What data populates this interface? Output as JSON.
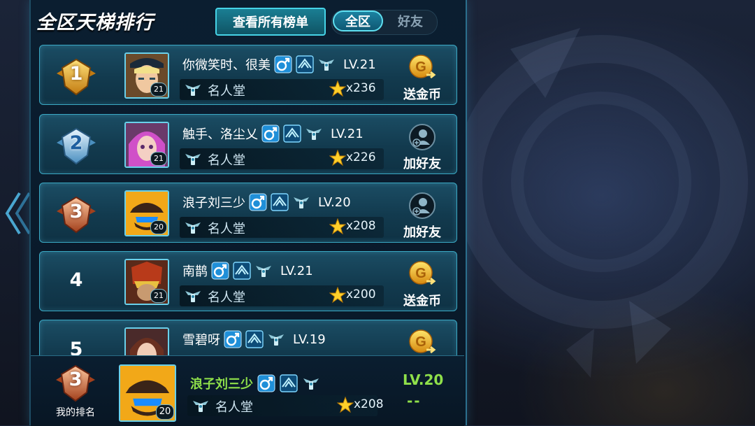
{
  "header": {
    "title": "全区天梯排行",
    "view_all_label": "查看所有榜单",
    "tabs": [
      {
        "label": "全区",
        "active": true
      },
      {
        "label": "好友",
        "active": false
      }
    ]
  },
  "colors": {
    "accent": "#46d3e6",
    "highlight_green": "#8fe04a",
    "panel_bg": "#123a4e",
    "gold": "#f2b21a"
  },
  "rankings": [
    {
      "rank": "1",
      "name": "你微笑时、很美",
      "level": "LV.21",
      "avatar_level": "21",
      "title": "名人堂",
      "stars": "x236",
      "action": "送金币",
      "action_icon": "gold-coin-send-icon"
    },
    {
      "rank": "2",
      "name": "触手、洛尘乂",
      "level": "LV.21",
      "avatar_level": "21",
      "title": "名人堂",
      "stars": "x226",
      "action": "加好友",
      "action_icon": "add-friend-icon"
    },
    {
      "rank": "3",
      "name": "浪子刘三少",
      "level": "LV.20",
      "avatar_level": "20",
      "title": "名人堂",
      "stars": "x208",
      "action": "加好友",
      "action_icon": "add-friend-icon"
    },
    {
      "rank": "4",
      "name": "南鹊",
      "level": "LV.21",
      "avatar_level": "21",
      "title": "名人堂",
      "stars": "x200",
      "action": "送金币",
      "action_icon": "gold-coin-send-icon"
    },
    {
      "rank": "5",
      "name": "雪碧呀",
      "level": "LV.19",
      "avatar_level": "",
      "title": "",
      "stars": "",
      "action": "",
      "action_icon": "gold-coin-send-icon"
    }
  ],
  "my_rank": {
    "rank": "3",
    "label": "我的排名",
    "name": "浪子刘三少",
    "level": "LV.20",
    "avatar_level": "20",
    "title": "名人堂",
    "stars": "x208",
    "extra": "--"
  }
}
